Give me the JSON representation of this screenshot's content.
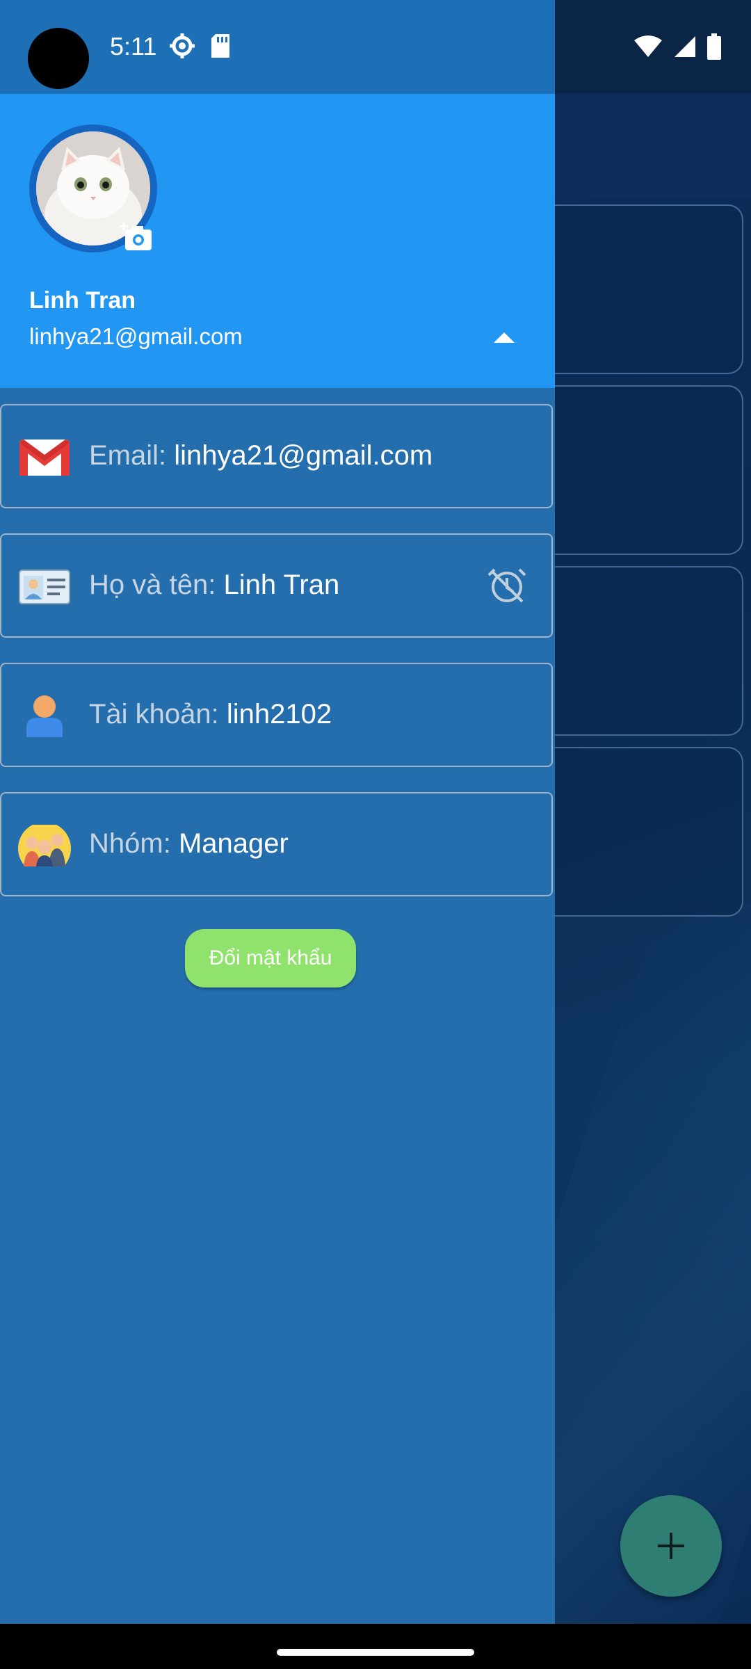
{
  "status_bar": {
    "time": "5:11",
    "left_icons": [
      "settings-gear-icon",
      "sd-card-icon"
    ],
    "right_icons": [
      "wifi-icon",
      "cell-signal-icon",
      "battery-icon"
    ]
  },
  "drawer": {
    "header": {
      "name": "Linh Tran",
      "email": "linhya21@gmail.com",
      "avatar": "cat-avatar",
      "change_photo_icon": "camera-add-icon",
      "toggle_icon": "arrow-up-icon"
    },
    "info": [
      {
        "label": "Email:",
        "value": "linhya21@gmail.com",
        "icon": "gmail-icon"
      },
      {
        "label": "Họ và tên:",
        "value": "Linh Tran",
        "icon": "id-card-icon",
        "trailing_icon": "edit-off-icon"
      },
      {
        "label": "Tài khoản:",
        "value": "linh2102",
        "icon": "user-icon"
      },
      {
        "label": "Nhóm:",
        "value": "Manager",
        "icon": "group-icon"
      }
    ],
    "change_password_button": "Đổi mật khẩu"
  },
  "fab": {
    "icon": "plus-icon"
  },
  "colors": {
    "drawer_header": "#2196f3",
    "drawer_body": "#246ead",
    "button": "#8fe36c",
    "fab": "#2f7e73"
  }
}
